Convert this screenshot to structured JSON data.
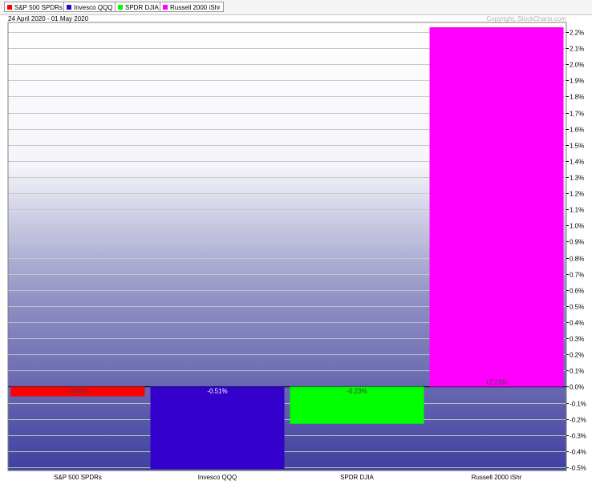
{
  "legend": [
    {
      "label": "S&P 500 SPDRs",
      "color": "#ff0000"
    },
    {
      "label": "Invesco QQQ",
      "color": "#3300cc"
    },
    {
      "label": "SPDR DJIA",
      "color": "#00ff00"
    },
    {
      "label": "Russell 2000 iShr",
      "color": "#ff00ff"
    }
  ],
  "date_range": "24 April 2020 - 01 May 2020",
  "copyright": "Copyright, StockCharts.com",
  "chart_data": {
    "type": "bar",
    "categories": [
      "S&P 500 SPDRs",
      "Invesco QQQ",
      "SPDR DJIA",
      "Russell 2000 iShr"
    ],
    "values": [
      -0.06,
      -0.51,
      -0.23,
      2.23
    ],
    "data_labels": [
      "-0.06%",
      "-0.51%",
      "-0.23%",
      "+2.23%"
    ],
    "colors": [
      "#ff0000",
      "#3300cc",
      "#00ff00",
      "#ff00ff"
    ],
    "ylim": [
      -0.52,
      2.26
    ],
    "yticks": [
      -0.5,
      -0.4,
      -0.3,
      -0.2,
      -0.1,
      0.0,
      0.1,
      0.2,
      0.3,
      0.4,
      0.5,
      0.6,
      0.7,
      0.8,
      0.9,
      1.0,
      1.1,
      1.2,
      1.3,
      1.4,
      1.5,
      1.6,
      1.7,
      1.8,
      1.9,
      2.0,
      2.1,
      2.2
    ],
    "ytick_labels": [
      "-0.5%",
      "-0.4%",
      "-0.3%",
      "-0.2%",
      "-0.1%",
      "0.0%",
      "0.1%",
      "0.2%",
      "0.3%",
      "0.4%",
      "0.5%",
      "0.6%",
      "0.7%",
      "0.8%",
      "0.9%",
      "1.0%",
      "1.1%",
      "1.2%",
      "1.3%",
      "1.4%",
      "1.5%",
      "1.6%",
      "1.7%",
      "1.8%",
      "1.9%",
      "2.0%",
      "2.1%",
      "2.2%"
    ],
    "grid": true,
    "yaxis_side": "right",
    "legend_position": "top-left"
  }
}
